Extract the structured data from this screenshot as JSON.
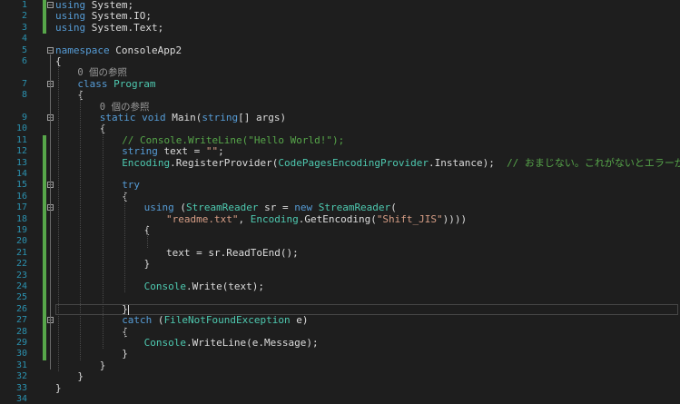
{
  "colors": {
    "background": "#1e1e1e",
    "line_number": "#2b91af",
    "keyword": "#569cd6",
    "type": "#4ec9b0",
    "string": "#d69d85",
    "comment": "#57a64a",
    "change_saved": "#57a64a"
  },
  "editor": {
    "lines": [
      {
        "n": "1",
        "saved": true,
        "fold": true,
        "tokens": [
          [
            "kw",
            "using"
          ],
          [
            "plain",
            " System;"
          ]
        ]
      },
      {
        "n": "2",
        "saved": true,
        "fold": false,
        "tokens": [
          [
            "kw",
            "using"
          ],
          [
            "plain",
            " System.IO;"
          ]
        ]
      },
      {
        "n": "3",
        "saved": true,
        "fold": false,
        "tokens": [
          [
            "kw",
            "using"
          ],
          [
            "plain",
            " System.Text;"
          ]
        ]
      },
      {
        "n": "4",
        "saved": false,
        "fold": false,
        "tokens": []
      },
      {
        "n": "5",
        "saved": false,
        "fold": true,
        "tokens": [
          [
            "kw",
            "namespace"
          ],
          [
            "plain",
            " ConsoleApp2"
          ]
        ]
      },
      {
        "n": "6",
        "saved": false,
        "fold": false,
        "tokens": [
          [
            "plain",
            "{"
          ]
        ]
      },
      {
        "n": "",
        "saved": false,
        "fold": false,
        "lens": true,
        "indent": 4,
        "tokens": [
          [
            "lens",
            "0 個の参照"
          ]
        ]
      },
      {
        "n": "7",
        "saved": false,
        "fold": true,
        "indent": 4,
        "tokens": [
          [
            "kw",
            "class"
          ],
          [
            "plain",
            " "
          ],
          [
            "ty",
            "Program"
          ]
        ]
      },
      {
        "n": "8",
        "saved": false,
        "fold": false,
        "indent": 4,
        "tokens": [
          [
            "plain",
            "{"
          ]
        ]
      },
      {
        "n": "",
        "saved": false,
        "fold": false,
        "lens": true,
        "indent": 8,
        "tokens": [
          [
            "lens",
            "0 個の参照"
          ]
        ]
      },
      {
        "n": "9",
        "saved": false,
        "fold": true,
        "indent": 8,
        "tokens": [
          [
            "kw",
            "static"
          ],
          [
            "plain",
            " "
          ],
          [
            "kw",
            "void"
          ],
          [
            "plain",
            " Main("
          ],
          [
            "kw",
            "string"
          ],
          [
            "plain",
            "[] args)"
          ]
        ]
      },
      {
        "n": "10",
        "saved": false,
        "fold": false,
        "indent": 8,
        "tokens": [
          [
            "plain",
            "{"
          ]
        ]
      },
      {
        "n": "11",
        "saved": true,
        "fold": false,
        "indent": 12,
        "tokens": [
          [
            "cm",
            "// Console.WriteLine(\"Hello World!\");"
          ]
        ]
      },
      {
        "n": "12",
        "saved": true,
        "fold": false,
        "indent": 12,
        "tokens": [
          [
            "kw",
            "string"
          ],
          [
            "plain",
            " text = "
          ],
          [
            "str",
            "\"\""
          ],
          [
            "plain",
            ";"
          ]
        ]
      },
      {
        "n": "13",
        "saved": true,
        "fold": false,
        "indent": 12,
        "tokens": [
          [
            "ty",
            "Encoding"
          ],
          [
            "plain",
            ".RegisterProvider("
          ],
          [
            "ty",
            "CodePagesEncodingProvider"
          ],
          [
            "plain",
            ".Instance);  "
          ],
          [
            "cm",
            "// おまじない。これがないとエラーが出る。"
          ]
        ]
      },
      {
        "n": "14",
        "saved": true,
        "fold": false,
        "tokens": []
      },
      {
        "n": "15",
        "saved": true,
        "fold": true,
        "indent": 12,
        "tokens": [
          [
            "kw",
            "try"
          ]
        ]
      },
      {
        "n": "16",
        "saved": true,
        "fold": false,
        "indent": 12,
        "tokens": [
          [
            "plain",
            "{"
          ]
        ]
      },
      {
        "n": "17",
        "saved": true,
        "fold": true,
        "indent": 16,
        "tokens": [
          [
            "kw",
            "using"
          ],
          [
            "plain",
            " ("
          ],
          [
            "ty",
            "StreamReader"
          ],
          [
            "plain",
            " sr = "
          ],
          [
            "kw",
            "new"
          ],
          [
            "plain",
            " "
          ],
          [
            "ty",
            "StreamReader"
          ],
          [
            "plain",
            "("
          ]
        ]
      },
      {
        "n": "18",
        "saved": true,
        "fold": false,
        "indent": 20,
        "tokens": [
          [
            "str",
            "\"readme.txt\""
          ],
          [
            "plain",
            ", "
          ],
          [
            "ty",
            "Encoding"
          ],
          [
            "plain",
            ".GetEncoding("
          ],
          [
            "str",
            "\"Shift_JIS\""
          ],
          [
            "plain",
            "))))"
          ]
        ]
      },
      {
        "n": "19",
        "saved": true,
        "fold": false,
        "indent": 16,
        "tokens": [
          [
            "plain",
            "{"
          ]
        ]
      },
      {
        "n": "20",
        "saved": true,
        "fold": false,
        "tokens": []
      },
      {
        "n": "21",
        "saved": true,
        "fold": false,
        "indent": 20,
        "tokens": [
          [
            "plain",
            "text = sr.ReadToEnd();"
          ]
        ]
      },
      {
        "n": "22",
        "saved": true,
        "fold": false,
        "indent": 16,
        "tokens": [
          [
            "plain",
            "}"
          ]
        ]
      },
      {
        "n": "23",
        "saved": true,
        "fold": false,
        "tokens": []
      },
      {
        "n": "24",
        "saved": true,
        "fold": false,
        "indent": 16,
        "tokens": [
          [
            "ty",
            "Console"
          ],
          [
            "plain",
            ".Write(text);"
          ]
        ]
      },
      {
        "n": "25",
        "saved": true,
        "fold": false,
        "tokens": []
      },
      {
        "n": "26",
        "saved": true,
        "fold": false,
        "current": true,
        "indent": 12,
        "tokens": [
          [
            "plain",
            "}"
          ]
        ]
      },
      {
        "n": "27",
        "saved": true,
        "fold": true,
        "indent": 12,
        "tokens": [
          [
            "kw",
            "catch"
          ],
          [
            "plain",
            " ("
          ],
          [
            "ty",
            "FileNotFoundException"
          ],
          [
            "plain",
            " e)"
          ]
        ]
      },
      {
        "n": "28",
        "saved": true,
        "fold": false,
        "indent": 12,
        "tokens": [
          [
            "plain",
            "{"
          ]
        ]
      },
      {
        "n": "29",
        "saved": true,
        "fold": false,
        "indent": 16,
        "tokens": [
          [
            "ty",
            "Console"
          ],
          [
            "plain",
            ".WriteLine(e.Message);"
          ]
        ]
      },
      {
        "n": "30",
        "saved": true,
        "fold": false,
        "indent": 12,
        "tokens": [
          [
            "plain",
            "}"
          ]
        ]
      },
      {
        "n": "31",
        "saved": false,
        "fold": false,
        "indent": 8,
        "tokens": [
          [
            "plain",
            "}"
          ]
        ]
      },
      {
        "n": "32",
        "saved": false,
        "fold": false,
        "indent": 4,
        "tokens": [
          [
            "plain",
            "}"
          ]
        ]
      },
      {
        "n": "33",
        "saved": false,
        "fold": false,
        "tokens": [
          [
            "plain",
            "}"
          ]
        ]
      },
      {
        "n": "34",
        "saved": false,
        "fold": false,
        "tokens": []
      }
    ]
  }
}
